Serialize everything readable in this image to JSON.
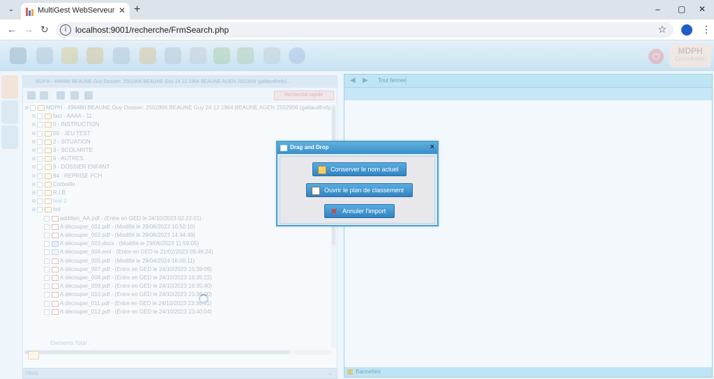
{
  "browser": {
    "tab_title": "MultiGest WebServeur - Admin",
    "url": "localhost:9001/recherche/FrmSearch.php",
    "new_tab": "+",
    "window_controls": [
      "–",
      "▢",
      "✕"
    ]
  },
  "app": {
    "badge": {
      "title": "MDPH",
      "subtitle": "Consultation"
    },
    "left_panel": {
      "header": "MDPH - 496480 BEAUNE Guy Dossier: 2502906 BEAUNE Guy 24 12 1964 BEAUNE AGEN 2502906 (galtaudfrefp)...",
      "search_placeholder": "Recherche rapide",
      "tree": [
        {
          "indent": 0,
          "icon": "root",
          "text": "MDPH - 496480 BEAUNE Guy Dossier: 2502906 BEAUNE Guy 24 12 1964 BEAUNE AGEN 2502906 (galtaudfrefp"
        },
        {
          "indent": 1,
          "icon": "folder",
          "text": "fact - AAAA - 11"
        },
        {
          "indent": 1,
          "icon": "folder",
          "text": "0 - INSTRUCTION"
        },
        {
          "indent": 1,
          "icon": "folder",
          "text": "00 - JEU TEST"
        },
        {
          "indent": 1,
          "icon": "folder",
          "text": "2 - SITUATION"
        },
        {
          "indent": 1,
          "icon": "folder",
          "text": "3 - SCOLARITE"
        },
        {
          "indent": 1,
          "icon": "folder",
          "text": "6 - AUTRES"
        },
        {
          "indent": 1,
          "icon": "folder",
          "text": "9 - DOSSIER ENFANT"
        },
        {
          "indent": 1,
          "icon": "folder",
          "text": "94 - REPRISE PCH"
        },
        {
          "indent": 1,
          "icon": "folder",
          "text": "Corbeille"
        },
        {
          "indent": 1,
          "icon": "folder",
          "text": "R.I.B"
        },
        {
          "indent": 1,
          "icon": "folder",
          "text": "test 2",
          "hl": "hl1"
        },
        {
          "indent": 1,
          "icon": "folder",
          "text": "tmi"
        },
        {
          "indent": 2,
          "icon": "pdf",
          "text": "addition_AA.pdf - (Entre en GED le 24/10/2023 02:22:01)"
        },
        {
          "indent": 2,
          "icon": "pdf",
          "text": "A découper_001.pdf - (Modifié le 29/06/2023 10:50:16)"
        },
        {
          "indent": 2,
          "icon": "pdf",
          "text": "A découper_002.pdf - (Modifié le 29/06/2023 14:44:49)"
        },
        {
          "indent": 2,
          "icon": "doc",
          "text": "A découper_003.docx - (Modifié le 29/06/2023 11:59:05)"
        },
        {
          "indent": 2,
          "icon": "mail",
          "text": "A découper_004.eml - (Entre en GED le 21/02/2023 09:46:24)"
        },
        {
          "indent": 2,
          "icon": "pdf",
          "text": "A découper_005.pdf - (Modifié le 29/04/2024 16:00:11)"
        },
        {
          "indent": 2,
          "icon": "pdf",
          "text": "A découper_007.pdf - (Entre en GED le 24/10/2023 15:39:09)"
        },
        {
          "indent": 2,
          "icon": "pdf",
          "text": "A découper_008.pdf - (Entre en GED le 24/10/2023 16:35:22)"
        },
        {
          "indent": 2,
          "icon": "pdf",
          "text": "A découper_009.pdf - (Entre en GED le 24/10/2023 16:35:40)"
        },
        {
          "indent": 2,
          "icon": "pdf",
          "text": "A découper_010.pdf - (Entre en GED le 24/10/2023 23:36:00)"
        },
        {
          "indent": 2,
          "icon": "pdf",
          "text": "A découper_011.pdf - (Entre en GED le 24/10/2023 23:36:01)"
        },
        {
          "indent": 2,
          "icon": "pdf",
          "text": "A découper_012.pdf - (Entre en GED le 24/10/2023 23:40:04)"
        }
      ],
      "lower_header": "Histo",
      "elements_label": "Elements Total :"
    },
    "right_panel": {
      "header_label": "Tout fermer",
      "footer_label": "Bannettes"
    }
  },
  "dialog": {
    "title": "Drag and Drop",
    "close": "×",
    "buttons": {
      "keep_name": "Conserver le nom actuel",
      "open_plan": "Ouvrir le plan de classement",
      "cancel": "Annuler l'import"
    }
  },
  "colors": {
    "dialog_title": "#3a8ec7",
    "dialog_button": "#3183c1",
    "panel_header": "#bfe4f4"
  }
}
